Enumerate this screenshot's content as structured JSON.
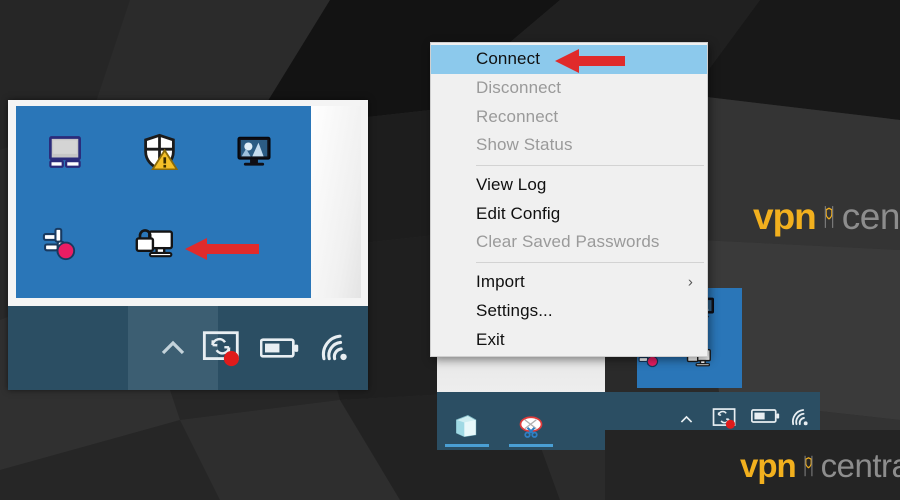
{
  "scene": {
    "description": "Windows 10 system tray with OpenVPN GUI context menu open",
    "background_style": "dark low-poly polygon"
  },
  "context_menu": {
    "name": "openvpn-gui-tray-menu",
    "items": [
      {
        "label": "Connect",
        "state": "highlighted",
        "submenu": false
      },
      {
        "label": "Disconnect",
        "state": "disabled",
        "submenu": false
      },
      {
        "label": "Reconnect",
        "state": "disabled",
        "submenu": false
      },
      {
        "label": "Show Status",
        "state": "disabled",
        "submenu": false
      },
      {
        "label": "__separator__",
        "state": "separator",
        "submenu": false
      },
      {
        "label": "View Log",
        "state": "enabled",
        "submenu": false
      },
      {
        "label": "Edit Config",
        "state": "enabled",
        "submenu": false
      },
      {
        "label": "Clear Saved Passwords",
        "state": "disabled",
        "submenu": false
      },
      {
        "label": "__separator__",
        "state": "separator",
        "submenu": false
      },
      {
        "label": "Import",
        "state": "enabled",
        "submenu": true,
        "submenu_glyph": "›"
      },
      {
        "label": "Settings...",
        "state": "enabled",
        "submenu": false
      },
      {
        "label": "Exit",
        "state": "enabled",
        "submenu": false
      }
    ]
  },
  "tray_popup": {
    "name": "hidden-icons-flyout",
    "background_color": "#2a76b8",
    "icons": [
      {
        "name": "display-settings-icon",
        "row": 0,
        "col": 0
      },
      {
        "name": "windows-defender-warning-icon",
        "row": 0,
        "col": 1
      },
      {
        "name": "monitor-media-icon",
        "row": 0,
        "col": 2
      },
      {
        "name": "pinwheel-badge-icon",
        "row": 1,
        "col": 0
      },
      {
        "name": "openvpn-gui-icon",
        "row": 1,
        "col": 1
      }
    ]
  },
  "taskbar": {
    "name": "windows-taskbar",
    "background_color": "#2b4e63",
    "tray_icons": [
      {
        "name": "show-hidden-icons-chevron",
        "glyph": "˄"
      },
      {
        "name": "onedrive-sync-error-icon"
      },
      {
        "name": "battery-icon"
      },
      {
        "name": "wifi-icon"
      }
    ],
    "app_buttons": [
      {
        "name": "sticky-notes-taskbar-button"
      },
      {
        "name": "snipping-tool-taskbar-button"
      }
    ]
  },
  "annotations": {
    "arrow_color": "#e02b2b",
    "arrows": [
      {
        "name": "arrow-pointing-to-connect-menu-item",
        "target": "Connect"
      },
      {
        "name": "arrow-pointing-to-openvpn-tray-icon",
        "target": "OpenVPN GUI tray icon"
      }
    ]
  },
  "watermark": {
    "vpn_text": "vpn",
    "central_text": "central",
    "vpn_color": "#f2b01e",
    "central_color": "#8d8d8d"
  }
}
